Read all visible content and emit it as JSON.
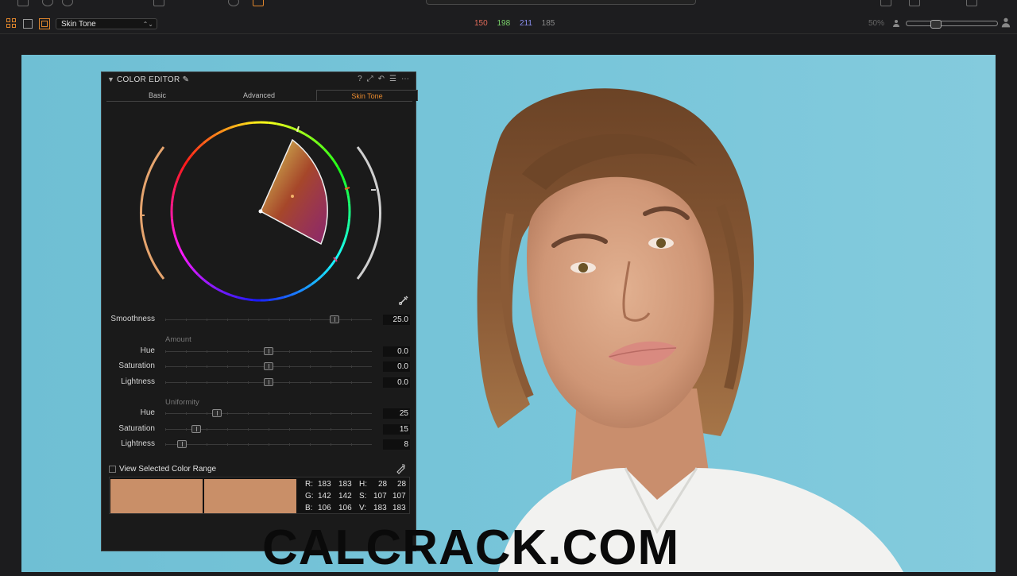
{
  "toolbar": {
    "preset": "Skin Tone",
    "rgb": {
      "r": "150",
      "g": "198",
      "b": "211",
      "a": "185"
    },
    "rgb_colors": {
      "r": "#e06b5a",
      "g": "#7bd36b",
      "b": "#8a8ef0",
      "a": "#8a8a8a"
    },
    "zoom": "50%"
  },
  "panel": {
    "title": "COLOR EDITOR",
    "tabs": [
      {
        "label": "Basic"
      },
      {
        "label": "Advanced"
      },
      {
        "label": "Skin Tone"
      }
    ],
    "active_tab": "Skin Tone",
    "smoothness": {
      "label": "Smoothness",
      "value": "25.0",
      "level": 0.82
    },
    "amount": {
      "label": "Amount",
      "hue": {
        "label": "Hue",
        "value": "0.0",
        "level": 0.5
      },
      "saturation": {
        "label": "Saturation",
        "value": "0.0",
        "level": 0.5
      },
      "lightness": {
        "label": "Lightness",
        "value": "0.0",
        "level": 0.5
      }
    },
    "uniformity": {
      "label": "Uniformity",
      "hue": {
        "label": "Hue",
        "value": "25",
        "level": 0.25
      },
      "saturation": {
        "label": "Saturation",
        "value": "15",
        "level": 0.15
      },
      "lightness": {
        "label": "Lightness",
        "value": "8",
        "level": 0.08
      }
    },
    "view_range_label": "View Selected Color Range",
    "swatch_color": "#b78e6a",
    "swatch_display": "#c98f68",
    "readouts": {
      "R": [
        "183",
        "183"
      ],
      "G": [
        "142",
        "142"
      ],
      "B": [
        "106",
        "106"
      ],
      "H": [
        "28",
        "28"
      ],
      "S": [
        "107",
        "107"
      ],
      "V": [
        "183",
        "183"
      ]
    },
    "readout_labels": {
      "R": "R:",
      "G": "G:",
      "B": "B:",
      "H": "H:",
      "S": "S:",
      "V": "V:"
    }
  },
  "watermark": "CALCRACK.COM",
  "colors": {
    "accent": "#e98a2e",
    "viewer_bg": "#72c3d8"
  }
}
